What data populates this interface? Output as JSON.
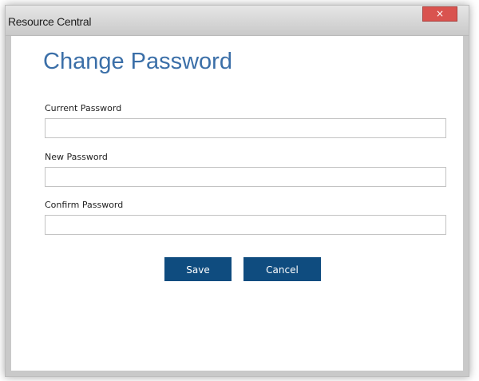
{
  "window": {
    "title": "Resource Central",
    "close_glyph": "×"
  },
  "page": {
    "title": "Change Password"
  },
  "fields": {
    "current_password": {
      "label": "Current Password",
      "value": ""
    },
    "new_password": {
      "label": "New Password",
      "value": ""
    },
    "confirm_password": {
      "label": "Confirm Password",
      "value": ""
    }
  },
  "actions": {
    "save_label": "Save",
    "cancel_label": "Cancel"
  },
  "colors": {
    "title_accent": "#3b6fa8",
    "button_bg": "#0f4c7f",
    "close_bg": "#d9534f"
  }
}
